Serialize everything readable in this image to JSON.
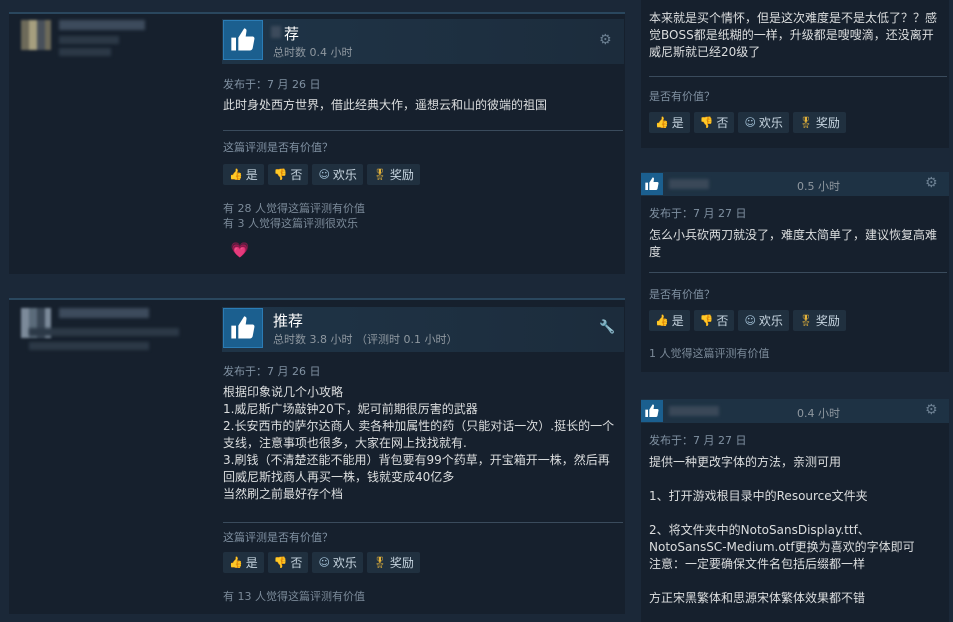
{
  "reviews_left": [
    {
      "recommendation": "荐",
      "hours": "总时数 0.4 小时",
      "posted": "发布于：7 月 26 日",
      "text": "此时身处西方世界，借此经典大作，遥想云和山的彼端的祖国",
      "question": "这篇评测是否有价值？",
      "buttons": {
        "yes": "是",
        "no": "否",
        "funny": "欢乐",
        "award": "奖励"
      },
      "helpful_lines": [
        "有 28 人觉得这篇评测有价值",
        "有 3 人觉得这篇评测很欢乐"
      ]
    },
    {
      "recommendation": "推荐",
      "hours": "总时数 3.8 小时 （评测时 0.1 小时）",
      "posted": "发布于：7 月 26 日",
      "text": "根据印象说几个小攻略\n1.威尼斯广场敲钟20下，妮可前期很厉害的武器\n2.长安西市的萨尔达商人 卖各种加属性的药（只能对话一次）.挺长的一个支线，注意事项也很多，大家在网上找找就有.\n3.刷钱（不清楚还能不能用）背包要有99个药草，开宝箱开一株，然后再回威尼斯找商人再买一株，钱就变成40亿多\n当然刷之前最好存个档",
      "question": "这篇评测是否有价值？",
      "buttons": {
        "yes": "是",
        "no": "否",
        "funny": "欢乐",
        "award": "奖励"
      },
      "helpful_lines": [
        "有 13 人觉得这篇评测有价值"
      ]
    }
  ],
  "reviews_right": [
    {
      "text": "本来就是买个情怀，但是这次难度是不是太低了？？感觉BOSS都是纸糊的一样，升级都是嗖嗖滴，还没离开威尼斯就已经20级了",
      "question": "是否有价值？",
      "buttons": {
        "yes": "是",
        "no": "否",
        "funny": "欢乐",
        "award": "奖励"
      }
    },
    {
      "hours": "0.5 小时",
      "posted": "发布于：7 月 27 日",
      "text": "怎么小兵砍两刀就没了，难度太简单了，建议恢复高难度",
      "question": "是否有价值？",
      "buttons": {
        "yes": "是",
        "no": "否",
        "funny": "欢乐",
        "award": "奖励"
      },
      "helpful": "1 人觉得这篇评测有价值"
    },
    {
      "hours": "0.4 小时",
      "posted": "发布于：7 月 27 日",
      "text": "提供一种更改字体的方法，亲测可用\n\n1、打开游戏根目录中的Resource文件夹\n\n2、将文件夹中的NotoSansDisplay.ttf、NotoSansSC-Medium.otf更换为喜欢的字体即可\n注意：一定要确保文件名包括后缀都一样\n\n方正宋黑繁体和思源宋体繁体效果都不错"
    }
  ],
  "colors": {
    "background": "#1b2838",
    "card": "#16202d",
    "accent": "#1b5f8f",
    "award": "#e6b43a"
  }
}
